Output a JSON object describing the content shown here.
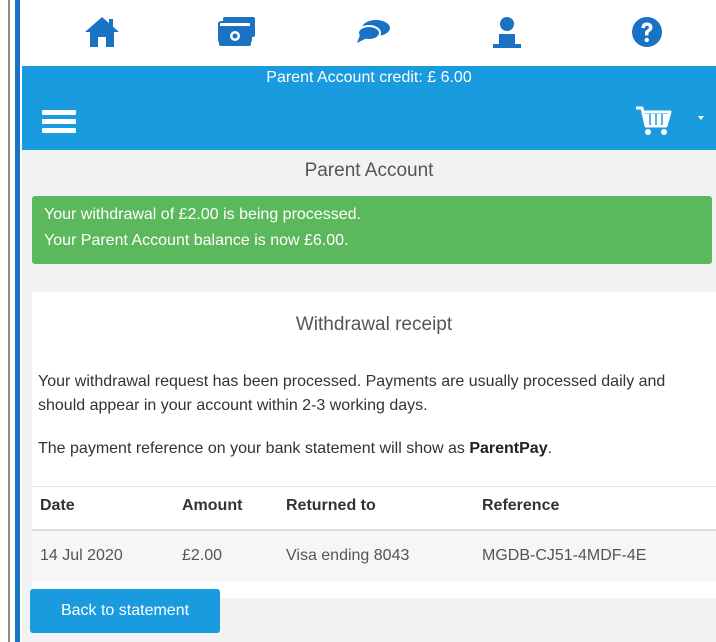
{
  "header": {
    "icons": [
      "home-icon",
      "money-icon",
      "chat-icon",
      "user-icon",
      "help-icon"
    ],
    "credit_text": "Parent Account credit: £ 6.00"
  },
  "nav": {
    "menu_icon": "hamburger-icon",
    "cart_icon": "cart-icon"
  },
  "page": {
    "title": "Parent Account"
  },
  "alert": {
    "line1": "Your withdrawal of £2.00 is being processed.",
    "line2": "Your Parent Account balance is now £6.00."
  },
  "receipt": {
    "title": "Withdrawal receipt",
    "para1": "Your withdrawal request has been processed. Payments are usually processed daily and should appear in your account within 2-3 working days.",
    "para2_prefix": "The payment reference on your bank statement will show as ",
    "para2_bold": "ParentPay",
    "para2_suffix": "."
  },
  "table": {
    "headers": [
      "Date",
      "Amount",
      "Returned to",
      "Reference"
    ],
    "rows": [
      [
        "14 Jul 2020",
        "£2.00",
        "Visa ending 8043",
        "MGDB-CJ51-4MDF-4E"
      ]
    ]
  },
  "actions": {
    "back_label": "Back to statement"
  },
  "colors": {
    "brand": "#1a9be0",
    "success": "#5cb85c",
    "icon_blue": "#1a72c4"
  }
}
